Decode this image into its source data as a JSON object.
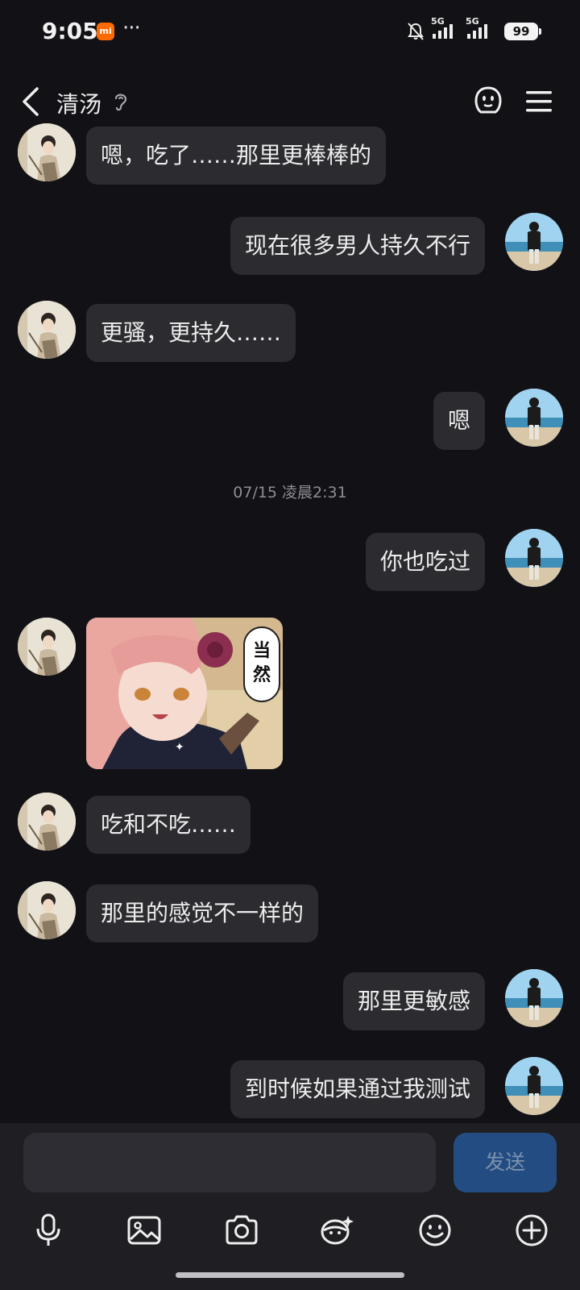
{
  "status_bar": {
    "time": "9:05",
    "mi_label": "mi",
    "dots": "···",
    "network1": "5G",
    "network2": "5G",
    "battery": "99"
  },
  "header": {
    "title": "清汤"
  },
  "messages": [
    {
      "side": "left",
      "text": "嗯，吃了……那里更棒棒的"
    },
    {
      "side": "right",
      "text": "现在很多男人持久不行"
    },
    {
      "side": "left",
      "text": "更骚，更持久……"
    },
    {
      "side": "right",
      "text": "嗯"
    },
    {
      "side": "right",
      "text": "你也吃过"
    },
    {
      "side": "left",
      "type": "sticker",
      "text": "当然"
    },
    {
      "side": "left",
      "text": "吃和不吃……"
    },
    {
      "side": "left",
      "text": "那里的感觉不一样的"
    },
    {
      "side": "right",
      "text": "那里更敏感"
    },
    {
      "side": "right",
      "text": "到时候如果通过我测试"
    }
  ],
  "timestamp": "07/15 凌晨2:31",
  "input": {
    "value": "",
    "send_label": "发送"
  },
  "toolbar": [
    "mic-icon",
    "image-icon",
    "camera-icon",
    "sticker-icon",
    "emoji-icon",
    "plus-icon"
  ]
}
